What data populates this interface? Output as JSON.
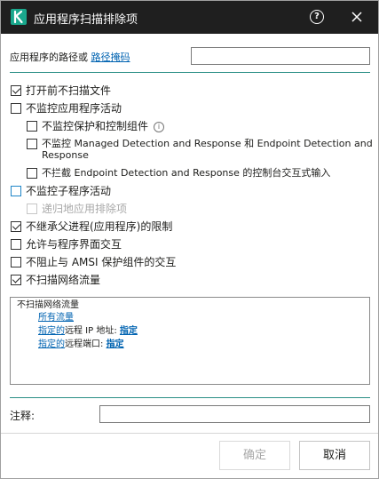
{
  "window": {
    "title": "应用程序扫描排除项",
    "logo_icon": "kaspersky-logo",
    "help_icon": "help-circle-icon",
    "help_glyph": "?",
    "close_icon": "close-icon",
    "title_bg": "#1f1f1f",
    "accent": "#1aa88d"
  },
  "path": {
    "label": "应用程序的路径或",
    "link": "路径掩码",
    "value": ""
  },
  "options": [
    {
      "label": "打开前不扫描文件",
      "checked": true,
      "enabled": true
    },
    {
      "label": "不监控应用程序活动",
      "checked": false,
      "enabled": true
    },
    {
      "label": "不监控保护和控制组件",
      "checked": false,
      "enabled": true,
      "info_icon": "info-icon",
      "info_glyph": "i"
    },
    {
      "label": "不监控 Managed Detection and Response 和 Endpoint Detection and",
      "label_cont": "Response",
      "checked": false,
      "enabled": true
    },
    {
      "label": "不拦截 Endpoint Detection and Response 的控制台交互式输入",
      "checked": false,
      "enabled": true
    },
    {
      "label": "不监控子程序活动",
      "checked": false,
      "enabled": true,
      "focused": true
    },
    {
      "label": "递归地应用排除项",
      "checked": false,
      "enabled": false
    },
    {
      "label": "不继承父进程(应用程序)的限制",
      "checked": true,
      "enabled": true
    },
    {
      "label": "允许与程序界面交互",
      "checked": false,
      "enabled": true
    },
    {
      "label": "不阻止与 AMSI 保护组件的交互",
      "checked": false,
      "enabled": true
    },
    {
      "label": "不扫描网络流量",
      "checked": true,
      "enabled": true
    }
  ],
  "network": {
    "header": "不扫描网络流量",
    "all_traffic_link": "所有流量",
    "ip_prefix_link": "指定的",
    "ip_text": "远程 IP 地址:",
    "ip_value_link": "指定",
    "port_prefix_link": "指定的",
    "port_text": "远程端口:",
    "port_value_link": "指定"
  },
  "comment": {
    "label": "注释:",
    "value": ""
  },
  "buttons": {
    "ok": "确定",
    "ok_enabled": false,
    "cancel": "取消"
  }
}
